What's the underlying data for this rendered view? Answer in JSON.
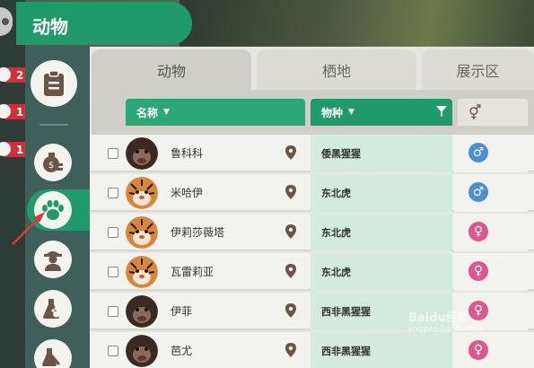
{
  "header": {
    "title": "动物"
  },
  "sidebar": {
    "items": [
      {
        "icon": "clipboard-icon",
        "label": ""
      },
      {
        "icon": "money-bag-icon",
        "label": ""
      },
      {
        "icon": "paw-icon",
        "label": ""
      },
      {
        "icon": "zookeeper-icon",
        "label": ""
      },
      {
        "icon": "research-paw-icon",
        "label": ""
      },
      {
        "icon": "research-tool-icon",
        "label": ""
      }
    ],
    "badges": [
      "2",
      "1",
      "1"
    ]
  },
  "tabs": [
    {
      "label": "动物",
      "active": true
    },
    {
      "label": "栖地",
      "active": false
    },
    {
      "label": "展示区",
      "active": false
    }
  ],
  "columns": {
    "name": "名称",
    "species": "物种",
    "gender_icon": "⚥"
  },
  "rows": [
    {
      "name": "鲁科科",
      "species": "倭黑猩猩",
      "gender": "male",
      "avatar": "chimp"
    },
    {
      "name": "米哈伊",
      "species": "东北虎",
      "gender": "male",
      "avatar": "tiger"
    },
    {
      "name": "伊莉莎薇塔",
      "species": "东北虎",
      "gender": "female",
      "avatar": "tiger"
    },
    {
      "name": "瓦雷莉亚",
      "species": "东北虎",
      "gender": "female",
      "avatar": "tiger"
    },
    {
      "name": "伊菲",
      "species": "西非黑猩猩",
      "gender": "female",
      "avatar": "chimp"
    },
    {
      "name": "芭尤",
      "species": "西非黑猩猩",
      "gender": "female",
      "avatar": "chimp"
    }
  ],
  "gender_symbols": {
    "male": "♂",
    "female": "♀"
  },
  "colors": {
    "accent": "#1f9a6a",
    "male": "#4a8fd0",
    "female": "#e0558e",
    "badge": "#d52e3a"
  },
  "watermark": {
    "text": "Baidu经验",
    "sub": "jingyan.baidu.com"
  }
}
